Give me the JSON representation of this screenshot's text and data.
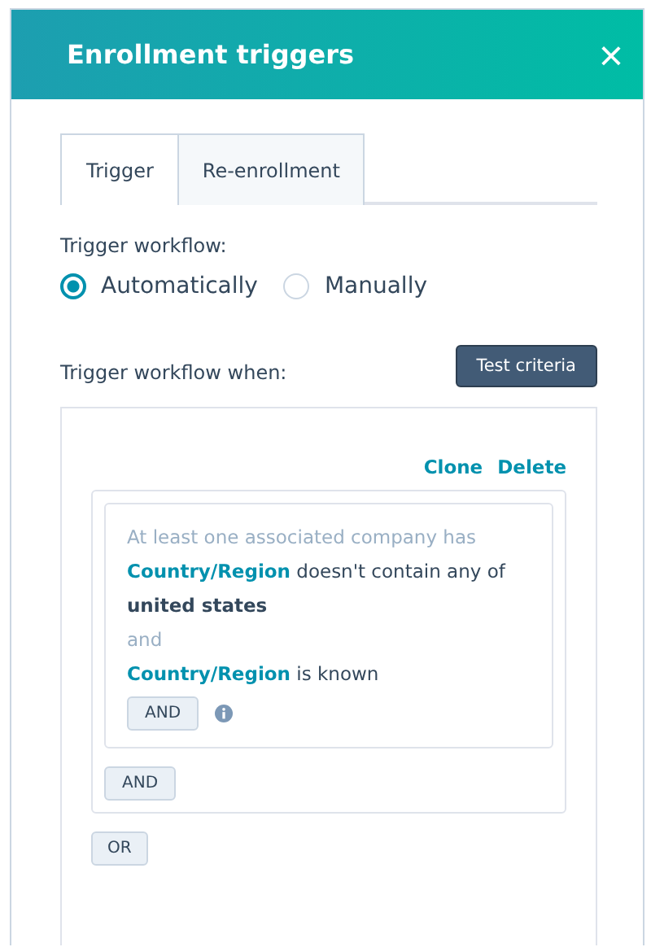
{
  "panel": {
    "title": "Enrollment triggers",
    "close": "×"
  },
  "tabs": [
    {
      "label": "Trigger",
      "selected": true
    },
    {
      "label": "Re-enrollment",
      "selected": false
    }
  ],
  "trigger_workflow": {
    "label": "Trigger workflow:",
    "options": [
      {
        "label": "Automatically",
        "selected": true
      },
      {
        "label": "Manually",
        "selected": false
      }
    ]
  },
  "criteria": {
    "label": "Trigger workflow when:",
    "test_button": "Test criteria",
    "group_actions": [
      "Clone",
      "Delete"
    ],
    "filter_card": {
      "heading": "At least one associated company has",
      "conditions": [
        {
          "property": "Country/Region",
          "text": "doesn't contain any of **united states**"
        },
        {
          "property": "Country/Region",
          "text": "is known"
        }
      ],
      "joiner": "and",
      "and_button": "AND"
    },
    "group_and_button": "AND",
    "or_button": "OR"
  }
}
